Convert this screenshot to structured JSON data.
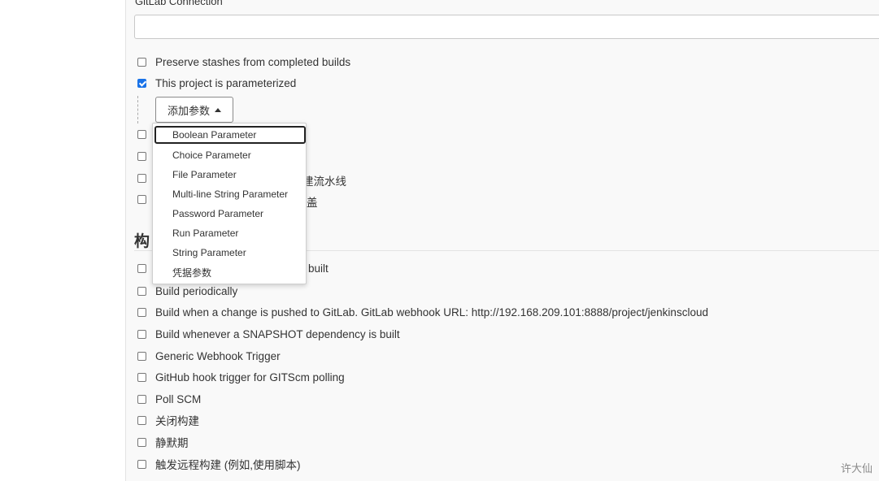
{
  "gitlab": {
    "label": "GitLab Connection",
    "value": ""
  },
  "general_options": [
    {
      "label": "Preserve stashes from completed builds",
      "checked": false
    },
    {
      "label": "This project is parameterized",
      "checked": true
    }
  ],
  "add_param_button": {
    "label": "添加参数"
  },
  "hidden_options_partial": [
    {
      "text": "",
      "checked": false
    },
    {
      "text": "",
      "checked": false
    },
    {
      "text": "建流水线",
      "checked": false
    },
    {
      "text": "盖",
      "checked": false
    }
  ],
  "dropdown": {
    "items": [
      "Boolean Parameter",
      "Choice Parameter",
      "File Parameter",
      "Multi-line String Parameter",
      "Password Parameter",
      "Run Parameter",
      "String Parameter",
      "凭据参数"
    ],
    "focused_index": 0
  },
  "triggers_section": {
    "title_partial": "构",
    "first_item_partial": "built",
    "items": [
      {
        "label": "Build periodically",
        "checked": false
      },
      {
        "label": "Build when a change is pushed to GitLab. GitLab webhook URL: http://192.168.209.101:8888/project/jenkinscloud",
        "checked": false
      },
      {
        "label": "Build whenever a SNAPSHOT dependency is built",
        "checked": false
      },
      {
        "label": "Generic Webhook Trigger",
        "checked": false
      },
      {
        "label": "GitHub hook trigger for GITScm polling",
        "checked": false
      },
      {
        "label": "Poll SCM",
        "checked": false
      },
      {
        "label": "关闭构建",
        "checked": false
      },
      {
        "label": "静默期",
        "checked": false
      },
      {
        "label": "触发远程构建 (例如,使用脚本)",
        "checked": false
      }
    ]
  },
  "watermark": "许大仙",
  "colors": {
    "checkbox_checked": "#1a73e8",
    "content_bg": "#f9f9f9"
  }
}
